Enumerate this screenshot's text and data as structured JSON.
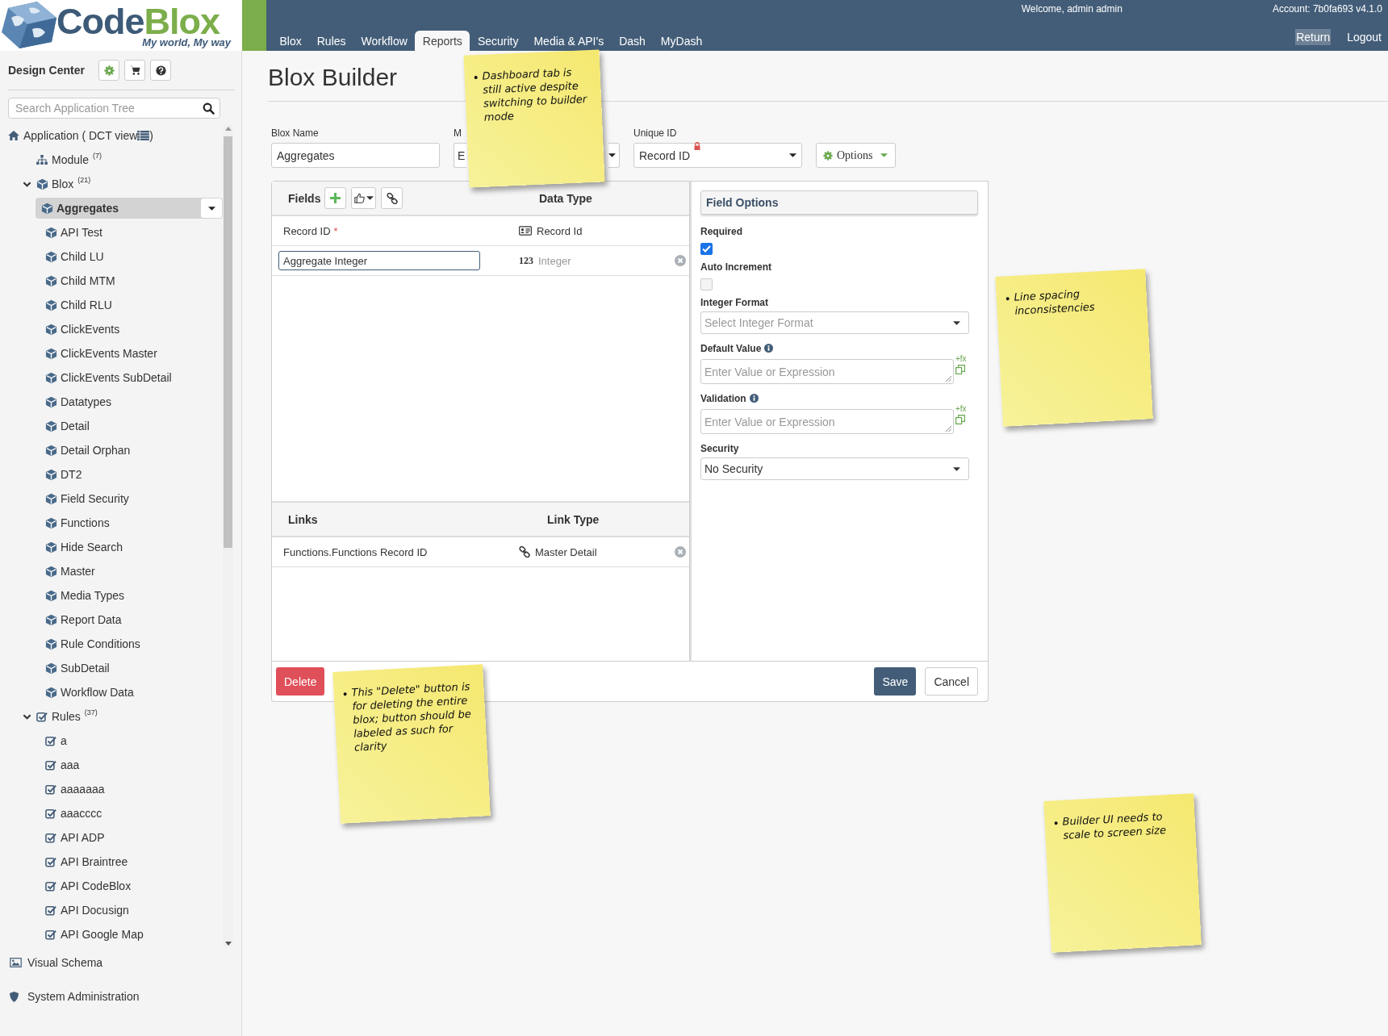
{
  "logo": {
    "first": "Code",
    "second": "Blox",
    "tagline": "My world, My way"
  },
  "nav": {
    "welcome": "Welcome, admin admin",
    "account": "Account: 7b0fa693 v4.1.0",
    "tabs": [
      {
        "label": "Blox",
        "selected": false
      },
      {
        "label": "Rules",
        "selected": false
      },
      {
        "label": "Workflow",
        "selected": false
      },
      {
        "label": "Reports",
        "selected": true
      },
      {
        "label": "Security",
        "selected": false
      },
      {
        "label": "Media & API's",
        "selected": false
      },
      {
        "label": "Dash",
        "selected": false
      },
      {
        "label": "MyDash",
        "selected": false
      }
    ],
    "links": [
      {
        "label": "Return",
        "selected": true
      },
      {
        "label": "Logout",
        "selected": false
      }
    ]
  },
  "sidebar": {
    "title": "Design Center",
    "search": {
      "placeholder": "Search Application Tree"
    },
    "tree": {
      "label": "Application ( DCT view",
      "suffix": ")",
      "kind": "app",
      "children": [
        {
          "label": "Module",
          "count": "(7)",
          "kind": "module"
        },
        {
          "label": "Blox",
          "count": "(21)",
          "kind": "blox",
          "expanded": true,
          "children": [
            {
              "label": "Aggregates",
              "kind": "blox",
              "selected": true
            },
            {
              "label": "API Test",
              "kind": "blox",
              "selected": false
            },
            {
              "label": "Child LU",
              "kind": "blox",
              "selected": false
            },
            {
              "label": "Child MTM",
              "kind": "blox",
              "selected": false
            },
            {
              "label": "Child RLU",
              "kind": "blox",
              "selected": false
            },
            {
              "label": "ClickEvents",
              "kind": "blox",
              "selected": false
            },
            {
              "label": "ClickEvents Master",
              "kind": "blox",
              "selected": false
            },
            {
              "label": "ClickEvents SubDetail",
              "kind": "blox",
              "selected": false
            },
            {
              "label": "Datatypes",
              "kind": "blox",
              "selected": false
            },
            {
              "label": "Detail",
              "kind": "blox",
              "selected": false
            },
            {
              "label": "Detail Orphan",
              "kind": "blox",
              "selected": false
            },
            {
              "label": "DT2",
              "kind": "blox",
              "selected": false
            },
            {
              "label": "Field Security",
              "kind": "blox",
              "selected": false
            },
            {
              "label": "Functions",
              "kind": "blox",
              "selected": false
            },
            {
              "label": "Hide Search",
              "kind": "blox",
              "selected": false
            },
            {
              "label": "Master",
              "kind": "blox",
              "selected": false
            },
            {
              "label": "Media Types",
              "kind": "blox",
              "selected": false
            },
            {
              "label": "Report Data",
              "kind": "blox",
              "selected": false
            },
            {
              "label": "Rule Conditions",
              "kind": "blox",
              "selected": false
            },
            {
              "label": "SubDetail",
              "kind": "blox",
              "selected": false
            },
            {
              "label": "Workflow Data",
              "kind": "blox",
              "selected": false
            }
          ]
        },
        {
          "label": "Rules",
          "count": "(37)",
          "kind": "rule",
          "expanded": true,
          "children": [
            {
              "label": "a",
              "kind": "rule",
              "selected": false
            },
            {
              "label": "aaa",
              "kind": "rule",
              "selected": false
            },
            {
              "label": "aaaaaaa",
              "kind": "rule",
              "selected": false
            },
            {
              "label": "aaacccc",
              "kind": "rule",
              "selected": false
            },
            {
              "label": "API ADP",
              "kind": "rule",
              "selected": false
            },
            {
              "label": "API Braintree",
              "kind": "rule",
              "selected": false
            },
            {
              "label": "API CodeBlox",
              "kind": "rule",
              "selected": false
            },
            {
              "label": "API Docusign",
              "kind": "rule",
              "selected": false
            },
            {
              "label": "API Google Map",
              "kind": "rule",
              "selected": false
            }
          ]
        }
      ]
    },
    "bottom_links": [
      {
        "label": "Visual Schema",
        "kind": "image"
      },
      {
        "label": "System Administration",
        "kind": "shield"
      }
    ]
  },
  "page": {
    "title": "Blox Builder"
  },
  "form": {
    "fields": [
      {
        "label": "Blox Name",
        "value": "Aggregates",
        "kind": "text"
      },
      {
        "label": "M",
        "value": "E",
        "kind": "select"
      },
      {
        "label": "Unique ID",
        "value": "Record ID",
        "kind": "select",
        "locked": true
      }
    ],
    "options_button": "Options"
  },
  "fields_panel": {
    "title": "Fields",
    "column_2": "Data Type",
    "rows": [
      {
        "name": "Record ID",
        "required_mark": "*",
        "type": "Record Id",
        "kind": "record",
        "editing": false,
        "removable": false
      },
      {
        "name": "Aggregate Integer",
        "type_badge": "123",
        "type": "Integer",
        "kind": "integer",
        "editing": true,
        "removable": true
      }
    ]
  },
  "links_panel": {
    "title": "Links",
    "column_2": "Link Type",
    "rows": [
      {
        "name": "Functions.Functions Record ID",
        "type": "Master Detail",
        "removable": true
      }
    ]
  },
  "field_options": {
    "title": "Field Options",
    "options": [
      {
        "kind": "checkbox",
        "label": "Required",
        "checked": true
      },
      {
        "kind": "checkbox",
        "label": "Auto Increment",
        "checked": false
      },
      {
        "kind": "select",
        "label": "Integer Format",
        "placeholder": "Select Integer Format"
      },
      {
        "kind": "expression",
        "label": "Default Value",
        "info": true,
        "placeholder": "Enter Value or Expression",
        "fx": "+fx"
      },
      {
        "kind": "expression",
        "label": "Validation",
        "info": true,
        "placeholder": "Enter Value or Expression",
        "fx": "+fx"
      },
      {
        "kind": "select",
        "label": "Security",
        "value": "No Security"
      }
    ]
  },
  "actions": {
    "delete": "Delete",
    "save": "Save",
    "cancel": "Cancel"
  },
  "notes": [
    {
      "text": "Dashboard tab is still active despite switching to builder mode"
    },
    {
      "text": "Line spacing inconsistencies"
    },
    {
      "text": "This \"Delete\" button is for deleting the entire blox; button should be labeled as such for clarity"
    },
    {
      "text": "Builder UI needs to scale to screen size"
    }
  ]
}
